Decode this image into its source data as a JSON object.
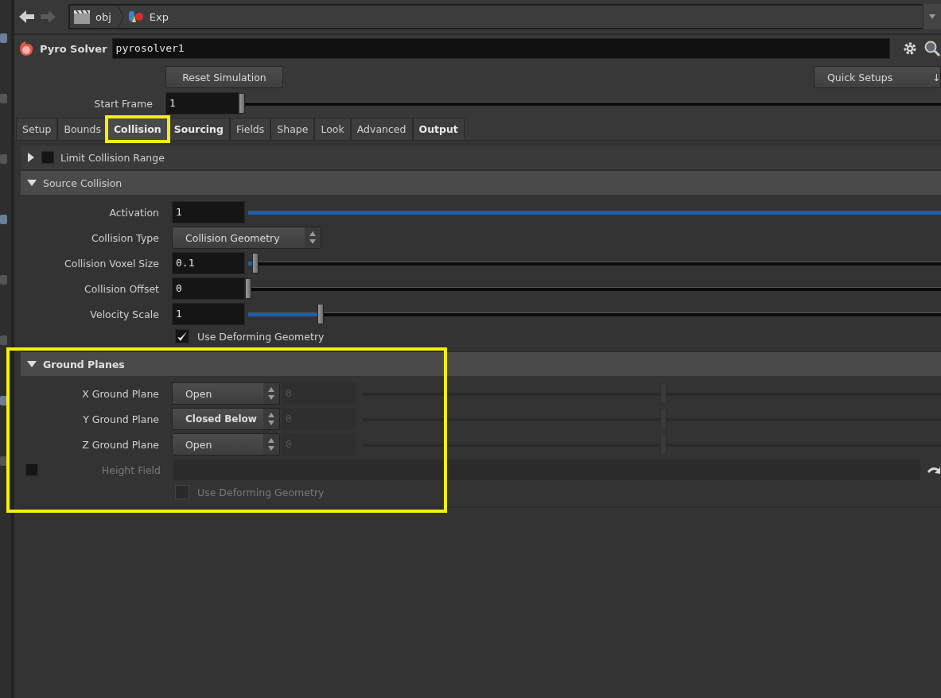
{
  "nav": {
    "path": [
      {
        "label": "obj",
        "kind": "network"
      },
      {
        "label": "Exp",
        "kind": "object"
      }
    ]
  },
  "node": {
    "type": "Pyro Solver",
    "name": "pyrosolver1"
  },
  "reset_button": "Reset Simulation",
  "quick_setups": {
    "label": "Quick Setups",
    "arrow": "↓"
  },
  "start_frame": {
    "label": "Start Frame",
    "value": "1",
    "level": 0
  },
  "tabs": [
    {
      "label": "Setup",
      "selected": false,
      "modified": false,
      "highlighted": false
    },
    {
      "label": "Bounds",
      "selected": false,
      "modified": false,
      "highlighted": false
    },
    {
      "label": "Collision",
      "selected": true,
      "modified": true,
      "highlighted": true
    },
    {
      "label": "Sourcing",
      "selected": false,
      "modified": true,
      "highlighted": false
    },
    {
      "label": "Fields",
      "selected": false,
      "modified": false,
      "highlighted": false
    },
    {
      "label": "Shape",
      "selected": false,
      "modified": false,
      "highlighted": false
    },
    {
      "label": "Look",
      "selected": false,
      "modified": false,
      "highlighted": false
    },
    {
      "label": "Advanced",
      "selected": false,
      "modified": false,
      "highlighted": false
    },
    {
      "label": "Output",
      "selected": false,
      "modified": true,
      "highlighted": false
    }
  ],
  "sections": [
    {
      "title": "Limit Collision Range",
      "expanded": false,
      "modified": false,
      "highlighted": false,
      "toggle": {
        "checked": false
      }
    },
    {
      "title": "Source Collision",
      "expanded": true,
      "modified": false,
      "highlighted": false,
      "parms": [
        {
          "kind": "slider",
          "label": "Activation",
          "value": "1",
          "level": 1,
          "disabled": false
        },
        {
          "kind": "menu",
          "label": "Collision Type",
          "value": "Collision Geometry",
          "modified": false
        },
        {
          "kind": "slider",
          "label": "Collision Voxel Size",
          "value": "0.1",
          "level": 0.01,
          "disabled": false
        },
        {
          "kind": "slider",
          "label": "Collision Offset",
          "value": "0",
          "level": 0,
          "disabled": false
        },
        {
          "kind": "slider",
          "label": "Velocity Scale",
          "value": "1",
          "level": 0.105,
          "disabled": false
        },
        {
          "kind": "toggle",
          "label": "Use Deforming Geometry",
          "checked": true,
          "disabled": false
        }
      ]
    },
    {
      "title": "Ground Planes",
      "expanded": true,
      "modified": true,
      "highlighted": true,
      "parms": [
        {
          "kind": "menu_slider",
          "label": "X Ground Plane",
          "value": "Open",
          "modified": false,
          "number": "0",
          "level": 0.52,
          "disabled": true
        },
        {
          "kind": "menu_slider",
          "label": "Y Ground Plane",
          "value": "Closed Below",
          "modified": true,
          "number": "0",
          "level": 0.52,
          "disabled": true
        },
        {
          "kind": "menu_slider",
          "label": "Z Ground Plane",
          "value": "Open",
          "modified": false,
          "number": "0",
          "level": 0.52,
          "disabled": true
        },
        {
          "kind": "path",
          "label": "Height Field",
          "checked": false,
          "disabled": true
        },
        {
          "kind": "toggle",
          "label": "Use Deforming Geometry",
          "checked": false,
          "disabled": true
        }
      ]
    }
  ]
}
